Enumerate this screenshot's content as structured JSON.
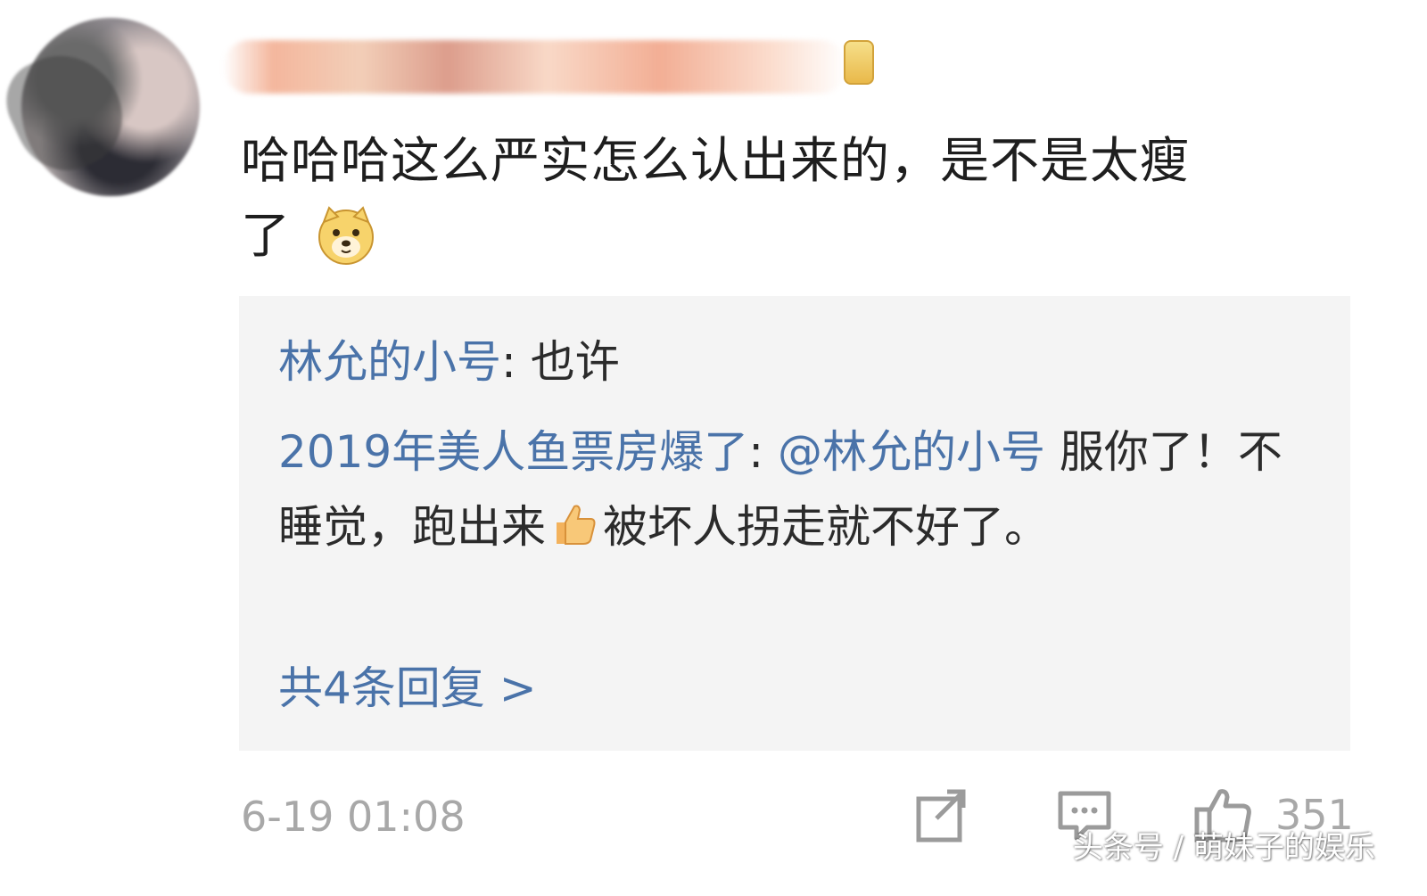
{
  "comment": {
    "text_line1": "哈哈哈这么严实怎么认出来的，是不是太瘦",
    "text_line2": "了",
    "emoji": "doge-icon"
  },
  "replies": [
    {
      "user": "林允的小号",
      "separator": ": ",
      "text": "也许"
    },
    {
      "user": "2019年美人鱼票房爆了",
      "separator": ": ",
      "mention": "@林允的小号",
      "text_part1": " 服你了！不睡觉，跑出来",
      "text_part2": "被坏人拐走就不好了。",
      "emoji": "thumbs-up-icon"
    }
  ],
  "more_replies": "共4条回复 >",
  "footer": {
    "timestamp": "6-19 01:08",
    "like_count": "351"
  },
  "watermark": "头条号 / 萌妹子的娱乐"
}
